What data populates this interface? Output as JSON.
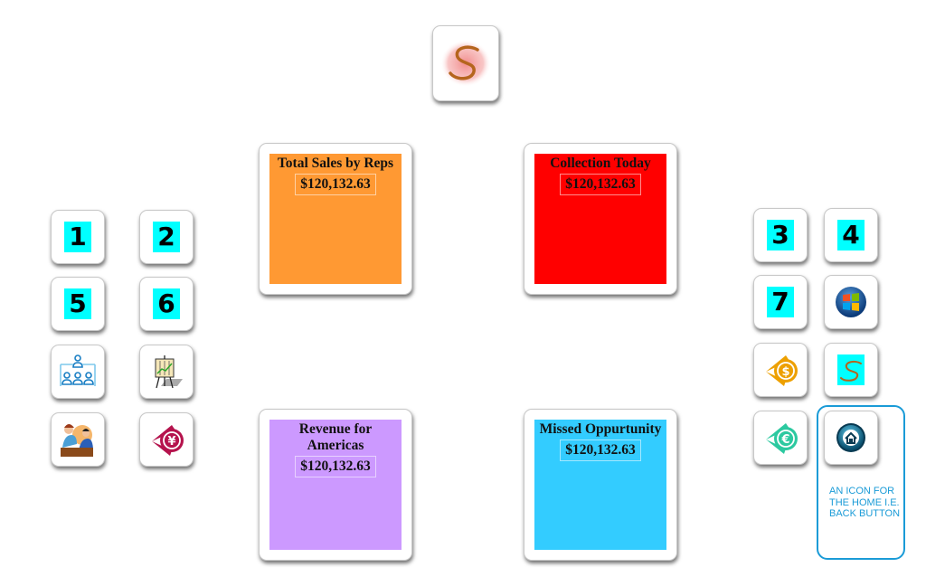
{
  "logo": {
    "icon": "s-logo-icon",
    "letter": "S"
  },
  "kpis": [
    {
      "id": "total-sales",
      "title": "Total Sales  by Reps",
      "value": "$120,132.63",
      "color": "#ff9933"
    },
    {
      "id": "collection-today",
      "title": "Collection Today",
      "value": "$120,132.63",
      "color": "#ff0000"
    },
    {
      "id": "revenue-americas",
      "title": "Revenue for Americas",
      "value": "$120,132.63",
      "color": "#cc99ff"
    },
    {
      "id": "missed-opportunity",
      "title": "Missed Oppurtunity",
      "value": "$120,132.63",
      "color": "#33ccff"
    }
  ],
  "left_icons": [
    {
      "label": "1",
      "icon": "number-1-icon"
    },
    {
      "label": "2",
      "icon": "number-2-icon"
    },
    {
      "label": "5",
      "icon": "number-5-icon"
    },
    {
      "label": "6",
      "icon": "number-6-icon"
    },
    {
      "icon": "org-chart-icon"
    },
    {
      "icon": "presentation-easel-icon"
    },
    {
      "icon": "meeting-people-icon"
    },
    {
      "icon": "yen-currency-icon"
    }
  ],
  "right_icons": [
    {
      "label": "3",
      "icon": "number-3-icon"
    },
    {
      "label": "4",
      "icon": "number-4-icon"
    },
    {
      "label": "7",
      "icon": "number-7-icon"
    },
    {
      "icon": "windows-logo-icon"
    },
    {
      "icon": "dollar-currency-icon"
    },
    {
      "label": "S",
      "icon": "s-logo-icon"
    },
    {
      "icon": "euro-currency-icon"
    },
    {
      "icon": "home-icon"
    }
  ],
  "annotation": {
    "text": "AN ICON FOR THE HOME I.E. BACK BUTTON"
  },
  "colors": {
    "digit_bg": "#00ffff",
    "annotation": "#1a9bd7"
  }
}
